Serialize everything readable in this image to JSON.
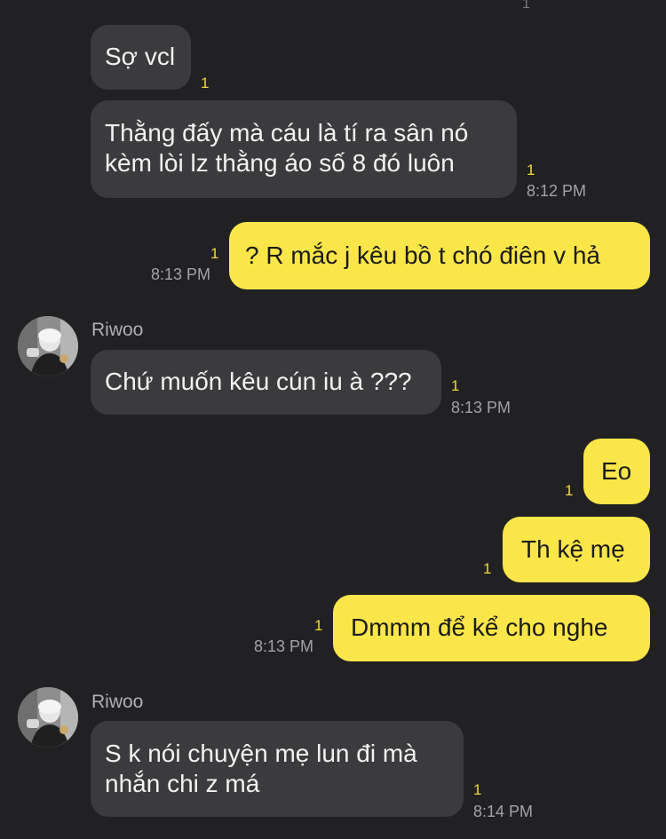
{
  "top_unread": "1",
  "colors": {
    "background": "#212123",
    "incoming_bubble": "#3b3b3d",
    "outgoing_bubble": "#fbe64a",
    "unread_count": "#f0d83a",
    "timestamp": "#a3a3a5"
  },
  "messages": [
    {
      "direction": "incoming",
      "text": "Sợ vcl",
      "unread": "1",
      "time": ""
    },
    {
      "direction": "incoming",
      "text": "Thằng đấy mà cáu là tí ra sân nó\nkèm lòi lz thằng áo số 8 đó luôn",
      "unread": "1",
      "time": "8:12 PM"
    },
    {
      "direction": "outgoing",
      "text": "? R mắc j kêu bồ t chó điên v hả",
      "unread": "1",
      "time": "8:13 PM"
    },
    {
      "direction": "incoming",
      "sender": "Riwoo",
      "avatar": "avatar-photo",
      "text": "Chứ muốn kêu cún iu à ???",
      "unread": "1",
      "time": "8:13 PM"
    },
    {
      "direction": "outgoing",
      "text": "Eo",
      "unread": "1",
      "time": ""
    },
    {
      "direction": "outgoing",
      "text": "Th kệ mẹ",
      "unread": "1",
      "time": ""
    },
    {
      "direction": "outgoing",
      "text": "Dmmm để kể cho nghe",
      "unread": "1",
      "time": "8:13 PM"
    },
    {
      "direction": "incoming",
      "sender": "Riwoo",
      "avatar": "avatar-photo",
      "text": "S k nói chuyện mẹ lun đi mà\nnhắn chi z má",
      "unread": "1",
      "time": "8:14 PM"
    }
  ]
}
